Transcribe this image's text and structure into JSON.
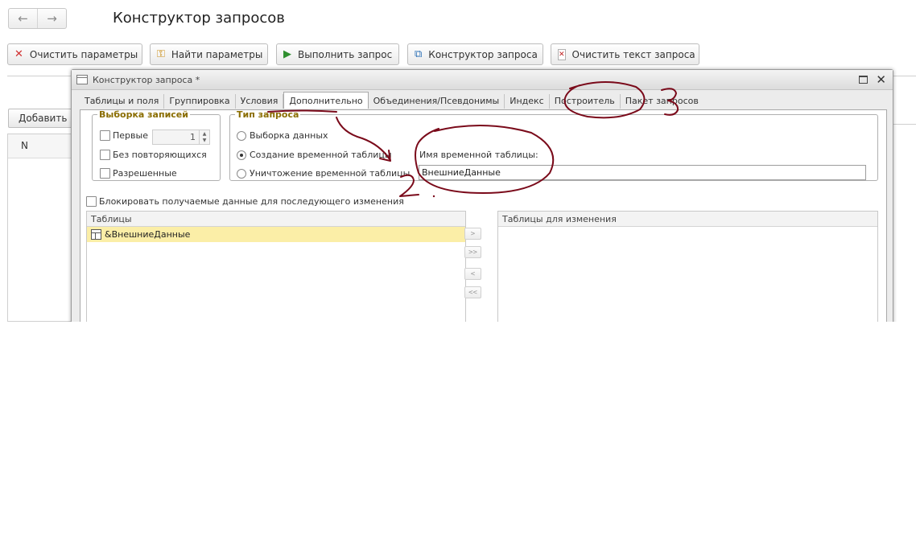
{
  "page": {
    "title": "Конструктор запросов",
    "nav": {
      "back_icon": "arrow-left-icon",
      "forward_icon": "arrow-right-icon"
    }
  },
  "toolbar": {
    "clear_params": "Очистить параметры",
    "find_params": "Найти параметры",
    "run_query": "Выполнить запрос",
    "query_builder": "Конструктор запроса",
    "clear_text": "Очистить текст запроса"
  },
  "background": {
    "add_button": "Добавить",
    "column_n": "N"
  },
  "dialog": {
    "title": "Конструктор запроса *",
    "tabs": [
      {
        "label": "Таблицы и поля"
      },
      {
        "label": "Группировка"
      },
      {
        "label": "Условия"
      },
      {
        "label": "Дополнительно",
        "active": true
      },
      {
        "label": "Объединения/Псевдонимы"
      },
      {
        "label": "Индекс"
      },
      {
        "label": "Построитель"
      },
      {
        "label": "Пакет запросов"
      }
    ],
    "record_selection": {
      "legend": "Выборка записей",
      "first_label": "Первые",
      "first_value": "1",
      "first_checked": false,
      "distinct_label": "Без повторяющихся",
      "distinct_checked": false,
      "allowed_label": "Разрешенные",
      "allowed_checked": false
    },
    "query_type": {
      "legend": "Тип запроса",
      "options": [
        {
          "label": "Выборка данных",
          "selected": false
        },
        {
          "label": "Создание временной таблицы",
          "selected": true
        },
        {
          "label": "Уничтожение временной таблицы",
          "selected": false
        }
      ]
    },
    "temp_table": {
      "label": "Имя временной таблицы:",
      "value": "ВнешниеДанные"
    },
    "lock_label": "Блокировать получаемые данные для последующего изменения",
    "lock_checked": false,
    "tables": {
      "header": "Таблицы",
      "items": [
        {
          "name": "&ВнешниеДанные",
          "selected": true
        }
      ]
    },
    "move_buttons": [
      ">",
      ">>",
      "<",
      "<<"
    ],
    "tables_to_change": {
      "header": "Таблицы для изменения",
      "items": []
    }
  },
  "annotations": {
    "color": "#7a0a1a",
    "label_2": "2",
    "label_3": "3"
  }
}
